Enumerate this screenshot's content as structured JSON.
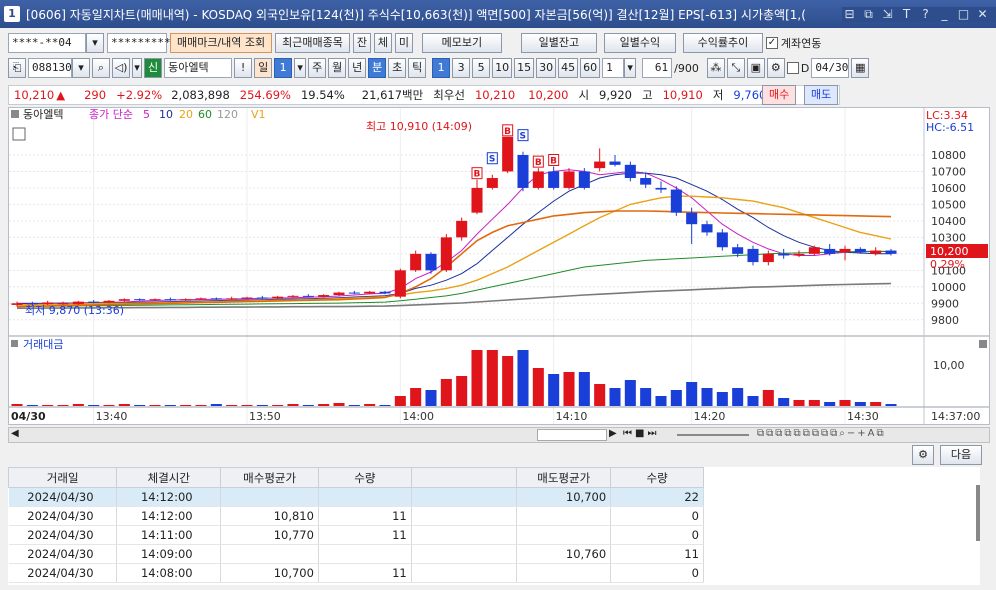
{
  "window": {
    "title": "[0606] 자동일지차트(매매내역) - KOSDAQ 외국인보유[124(천)] 주식수[10,663(천)] 액면[500] 자본금[56(억)] 결산[12월] EPS[-613] 시가총액[1,(",
    "icon_label": "1",
    "buttons": [
      "⊟",
      "⧉",
      "⇲",
      "T",
      "?",
      "_",
      "□",
      "✕"
    ]
  },
  "toolbar1": {
    "account": "****-**04",
    "password": "*********",
    "buy_sell_mark_btn": "매매마크/내역 조회",
    "recent_trades_btn": "최근매매종목",
    "btn_jan": "잔",
    "btn_che": "체",
    "btn_mi": "미",
    "memo_btn": "메모보기",
    "daily_balance_btn": "일별잔고",
    "daily_profit_btn": "일별수익",
    "profit_trend_btn": "수익률추이",
    "account_link_label": "계좌연동",
    "account_link_checked": "✓"
  },
  "toolbar2": {
    "stock_code": "088130",
    "market_tag": "신",
    "stock_name": "동아엘텍",
    "exclaim": "!",
    "period_label": "일",
    "period_value": "1",
    "periods": [
      "주",
      "월",
      "년",
      "분",
      "초",
      "틱"
    ],
    "intervals": [
      "1",
      "3",
      "5",
      "10",
      "15",
      "30",
      "45",
      "60"
    ],
    "interval_value": "1",
    "count_value": "61",
    "count_max": "/900",
    "date_value": "04/30",
    "d_label": "D"
  },
  "quote": {
    "price": "10,210",
    "arrow": "▲",
    "change": "290",
    "change_pct": "+2.92%",
    "volume": "2,083,898",
    "vol_ratio": "254.69%",
    "turnover": "19.54%",
    "amount": "21,617백만",
    "lowest_label": "최우선",
    "ask": "10,210",
    "bid": "10,200",
    "open_label": "시",
    "open": "9,920",
    "high_label": "고",
    "high": "10,910",
    "low_label": "저",
    "low": "9,760",
    "buy_btn": "매수",
    "sell_btn": "매도"
  },
  "chart": {
    "legend_stock": "동아엘텍",
    "legend_ma_label": "종가 단순",
    "ma_periods": [
      "5",
      "10",
      "20",
      "60",
      "120"
    ],
    "ma_colors": [
      "#c81ec8",
      "#1a2f9c",
      "#e8a317",
      "#1e8c28",
      "#7a7a7a"
    ],
    "legend_v": "V1",
    "lc_label": "LC:3.34",
    "hc_label": "HC:-6.51",
    "high_annot": "최고 10,910 (14:09)",
    "low_annot": "최저 9,870 (13:36)",
    "current_price_label": "10,200",
    "current_pct_label": "0.29%",
    "volume_panel_title": "거래대금",
    "volume_axis_label": "10,00",
    "date_label": "04/30",
    "time_labels": [
      "13:40",
      "13:50",
      "14:00",
      "14:10",
      "14:20",
      "14:30",
      "14:37:00"
    ],
    "trade_marks": [
      {
        "type": "B",
        "i": 30
      },
      {
        "type": "S",
        "i": 31
      },
      {
        "type": "B",
        "i": 32
      },
      {
        "type": "S",
        "i": 33
      },
      {
        "type": "B",
        "i": 34
      },
      {
        "type": "B",
        "i": 35
      }
    ]
  },
  "chart_data": {
    "type": "candlestick",
    "title": "동아엘텍",
    "xlabel": "",
    "ylabel": "",
    "ylim": [
      9750,
      11000
    ],
    "y_ticks": [
      10800,
      10700,
      10600,
      10500,
      10400,
      10300,
      10200,
      10100,
      10000,
      9900,
      9800
    ],
    "candles": [
      {
        "o": 9890,
        "c": 9900,
        "h": 9910,
        "l": 9880
      },
      {
        "o": 9900,
        "c": 9895,
        "h": 9910,
        "l": 9885
      },
      {
        "o": 9895,
        "c": 9905,
        "h": 9915,
        "l": 9890
      },
      {
        "o": 9900,
        "c": 9900,
        "h": 9910,
        "l": 9890
      },
      {
        "o": 9895,
        "c": 9910,
        "h": 9915,
        "l": 9890
      },
      {
        "o": 9910,
        "c": 9905,
        "h": 9920,
        "l": 9900
      },
      {
        "o": 9905,
        "c": 9915,
        "h": 9920,
        "l": 9900
      },
      {
        "o": 9915,
        "c": 9925,
        "h": 9930,
        "l": 9910
      },
      {
        "o": 9925,
        "c": 9920,
        "h": 9930,
        "l": 9915
      },
      {
        "o": 9920,
        "c": 9925,
        "h": 9930,
        "l": 9915
      },
      {
        "o": 9925,
        "c": 9920,
        "h": 9935,
        "l": 9915
      },
      {
        "o": 9920,
        "c": 9925,
        "h": 9930,
        "l": 9915
      },
      {
        "o": 9925,
        "c": 9930,
        "h": 9935,
        "l": 9920
      },
      {
        "o": 9930,
        "c": 9925,
        "h": 9935,
        "l": 9920
      },
      {
        "o": 9925,
        "c": 9930,
        "h": 9940,
        "l": 9920
      },
      {
        "o": 9930,
        "c": 9935,
        "h": 9940,
        "l": 9925
      },
      {
        "o": 9935,
        "c": 9930,
        "h": 9945,
        "l": 9925
      },
      {
        "o": 9930,
        "c": 9940,
        "h": 9945,
        "l": 9925
      },
      {
        "o": 9940,
        "c": 9945,
        "h": 9950,
        "l": 9935
      },
      {
        "o": 9945,
        "c": 9940,
        "h": 9955,
        "l": 9935
      },
      {
        "o": 9940,
        "c": 9950,
        "h": 9955,
        "l": 9935
      },
      {
        "o": 9950,
        "c": 9965,
        "h": 9970,
        "l": 9945
      },
      {
        "o": 9965,
        "c": 9960,
        "h": 9975,
        "l": 9955
      },
      {
        "o": 9960,
        "c": 9970,
        "h": 9975,
        "l": 9955
      },
      {
        "o": 9970,
        "c": 9960,
        "h": 9975,
        "l": 9955
      },
      {
        "o": 9940,
        "c": 10100,
        "h": 10110,
        "l": 9930
      },
      {
        "o": 10100,
        "c": 10200,
        "h": 10220,
        "l": 10090
      },
      {
        "o": 10200,
        "c": 10100,
        "h": 10210,
        "l": 10080
      },
      {
        "o": 10100,
        "c": 10300,
        "h": 10320,
        "l": 10090
      },
      {
        "o": 10300,
        "c": 10400,
        "h": 10420,
        "l": 10280
      },
      {
        "o": 10450,
        "c": 10600,
        "h": 10650,
        "l": 10440
      },
      {
        "o": 10600,
        "c": 10660,
        "h": 10680,
        "l": 10590
      },
      {
        "o": 10700,
        "c": 10910,
        "h": 10910,
        "l": 10690
      },
      {
        "o": 10800,
        "c": 10600,
        "h": 10820,
        "l": 10580
      },
      {
        "o": 10600,
        "c": 10700,
        "h": 10720,
        "l": 10590
      },
      {
        "o": 10700,
        "c": 10600,
        "h": 10730,
        "l": 10590
      },
      {
        "o": 10600,
        "c": 10700,
        "h": 10720,
        "l": 10590
      },
      {
        "o": 10700,
        "c": 10600,
        "h": 10720,
        "l": 10590
      },
      {
        "o": 10720,
        "c": 10760,
        "h": 10840,
        "l": 10700
      },
      {
        "o": 10760,
        "c": 10740,
        "h": 10800,
        "l": 10730
      },
      {
        "o": 10740,
        "c": 10660,
        "h": 10760,
        "l": 10640
      },
      {
        "o": 10660,
        "c": 10620,
        "h": 10690,
        "l": 10600
      },
      {
        "o": 10600,
        "c": 10590,
        "h": 10640,
        "l": 10570
      },
      {
        "o": 10590,
        "c": 10450,
        "h": 10610,
        "l": 10430
      },
      {
        "o": 10450,
        "c": 10380,
        "h": 10480,
        "l": 10260
      },
      {
        "o": 10380,
        "c": 10330,
        "h": 10400,
        "l": 10310
      },
      {
        "o": 10330,
        "c": 10240,
        "h": 10350,
        "l": 10220
      },
      {
        "o": 10240,
        "c": 10200,
        "h": 10260,
        "l": 10180
      },
      {
        "o": 10230,
        "c": 10150,
        "h": 10250,
        "l": 10130
      },
      {
        "o": 10150,
        "c": 10200,
        "h": 10220,
        "l": 10130
      },
      {
        "o": 10200,
        "c": 10190,
        "h": 10230,
        "l": 10170
      },
      {
        "o": 10190,
        "c": 10200,
        "h": 10220,
        "l": 10180
      },
      {
        "o": 10200,
        "c": 10240,
        "h": 10250,
        "l": 10190
      },
      {
        "o": 10230,
        "c": 10200,
        "h": 10260,
        "l": 10190
      },
      {
        "o": 10210,
        "c": 10230,
        "h": 10250,
        "l": 10160
      },
      {
        "o": 10230,
        "c": 10210,
        "h": 10240,
        "l": 10200
      },
      {
        "o": 10200,
        "c": 10220,
        "h": 10240,
        "l": 10190
      },
      {
        "o": 10220,
        "c": 10200,
        "h": 10230,
        "l": 10190
      }
    ],
    "volume": [
      2,
      1,
      1,
      1,
      2,
      1,
      1,
      2,
      1,
      1,
      1,
      1,
      1,
      2,
      1,
      1,
      1,
      1,
      2,
      1,
      2,
      3,
      1,
      2,
      1,
      10,
      18,
      16,
      27,
      30,
      56,
      56,
      50,
      56,
      38,
      32,
      34,
      34,
      22,
      18,
      26,
      18,
      10,
      16,
      24,
      18,
      14,
      18,
      10,
      16,
      8,
      6,
      6,
      4,
      6,
      4,
      4,
      2
    ],
    "lines": {
      "ma5": [
        9900,
        9900,
        9900,
        9902,
        9902,
        9905,
        9906,
        9908,
        9913,
        9917,
        9920,
        9922,
        9923,
        9925,
        9926,
        9928,
        9930,
        9932,
        9934,
        9937,
        9940,
        9944,
        9950,
        9957,
        9961,
        9990,
        10050,
        10090,
        10150,
        10220,
        10320,
        10410,
        10500,
        10600,
        10680,
        10700,
        10710,
        10700,
        10680,
        10690,
        10700,
        10690,
        10650,
        10600,
        10540,
        10460,
        10380,
        10320,
        10270,
        10230,
        10200,
        10190,
        10190,
        10200,
        10210,
        10215,
        10215,
        10215
      ],
      "ma10": [
        9898,
        9898,
        9899,
        9900,
        9900,
        9901,
        9902,
        9904,
        9906,
        9908,
        9910,
        9912,
        9914,
        9916,
        9918,
        9920,
        9922,
        9924,
        9926,
        9928,
        9931,
        9934,
        9938,
        9942,
        9946,
        9960,
        9990,
        10010,
        10040,
        10080,
        10140,
        10220,
        10300,
        10380,
        10450,
        10520,
        10580,
        10620,
        10660,
        10680,
        10690,
        10690,
        10680,
        10660,
        10620,
        10580,
        10530,
        10470,
        10420,
        10360,
        10310,
        10270,
        10240,
        10220,
        10210,
        10205,
        10200,
        10200
      ],
      "ma20": [
        9890,
        9892,
        9894,
        9895,
        9896,
        9898,
        9899,
        9900,
        9901,
        9902,
        9904,
        9906,
        9908,
        9910,
        9912,
        9914,
        9916,
        9918,
        9920,
        9922,
        9925,
        9928,
        9932,
        9936,
        9940,
        9950,
        9965,
        9975,
        9990,
        10010,
        10040,
        10080,
        10120,
        10170,
        10220,
        10270,
        10320,
        10370,
        10420,
        10460,
        10500,
        10520,
        10540,
        10550,
        10550,
        10545,
        10540,
        10530,
        10520,
        10500,
        10480,
        10450,
        10420,
        10390,
        10360,
        10330,
        10310,
        10290
      ],
      "ma60": [
        9880,
        9881,
        9882,
        9883,
        9884,
        9885,
        9886,
        9887,
        9888,
        9889,
        9890,
        9891,
        9892,
        9893,
        9894,
        9895,
        9896,
        9897,
        9898,
        9899,
        9900,
        9901,
        9903,
        9905,
        9907,
        9915,
        9925,
        9935,
        9945,
        9960,
        9980,
        10000,
        10020,
        10040,
        10060,
        10080,
        10100,
        10120,
        10130,
        10140,
        10150,
        10160,
        10165,
        10170,
        10175,
        10180,
        10185,
        10190,
        10195,
        10200,
        10203,
        10206,
        10208,
        10210,
        10212,
        10213,
        10214,
        10215
      ],
      "ma120": [
        9870,
        9870,
        9871,
        9871,
        9872,
        9872,
        9873,
        9873,
        9874,
        9874,
        9875,
        9875,
        9876,
        9876,
        9877,
        9877,
        9878,
        9878,
        9879,
        9879,
        9880,
        9880,
        9881,
        9882,
        9883,
        9886,
        9890,
        9894,
        9898,
        9902,
        9908,
        9914,
        9920,
        9926,
        9932,
        9938,
        9944,
        9950,
        9955,
        9960,
        9965,
        9970,
        9974,
        9978,
        9982,
        9986,
        9990,
        9994,
        9998,
        10000,
        10003,
        10006,
        10009,
        10012,
        10014,
        10016,
        10018,
        10020
      ],
      "orange": [
        9880,
        9882,
        9884,
        9886,
        9888,
        9890,
        9892,
        9894,
        9896,
        9898,
        9900,
        9902,
        9904,
        9906,
        9908,
        9910,
        9912,
        9914,
        9916,
        9918,
        9920,
        9922,
        9926,
        9930,
        9935,
        9960,
        10000,
        10050,
        10120,
        10200,
        10280,
        10330,
        10370,
        10390,
        10410,
        10430,
        10440,
        10450,
        10455,
        10460,
        10460,
        10460,
        10458,
        10455,
        10452,
        10450,
        10448,
        10446,
        10444,
        10442,
        10440,
        10438,
        10436,
        10434,
        10432,
        10430,
        10428,
        10426
      ]
    }
  },
  "grid": {
    "pager_btn": "다음",
    "columns": [
      "거래일",
      "체결시간",
      "매수평균가",
      "수량",
      "",
      "매도평균가",
      "수량"
    ],
    "rows": [
      [
        "2024/04/30",
        "14:12:00",
        "",
        "",
        "",
        "10,700",
        "22"
      ],
      [
        "2024/04/30",
        "14:12:00",
        "10,810",
        "11",
        "",
        "",
        "0"
      ],
      [
        "2024/04/30",
        "14:11:00",
        "10,770",
        "11",
        "",
        "",
        "0"
      ],
      [
        "2024/04/30",
        "14:09:00",
        "",
        "",
        "",
        "10,760",
        "11"
      ],
      [
        "2024/04/30",
        "14:08:00",
        "10,700",
        "11",
        "",
        "",
        "0"
      ]
    ]
  }
}
